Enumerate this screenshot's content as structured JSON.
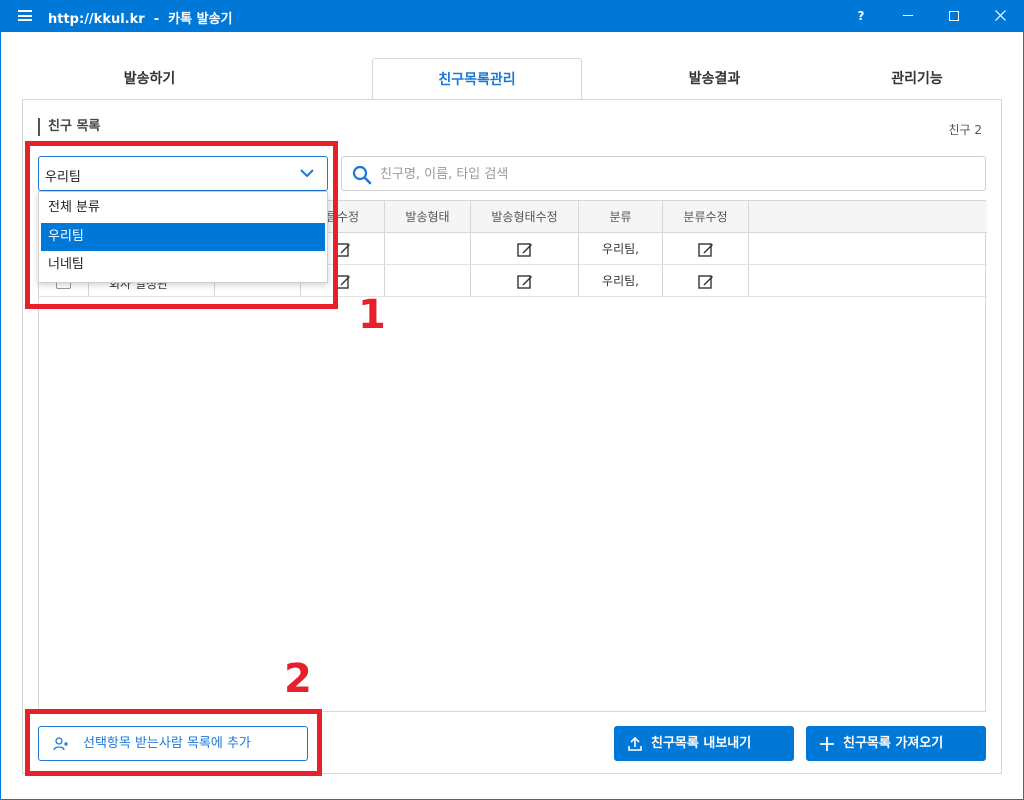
{
  "window": {
    "title": "http://kkul.kr  -  카톡 발송기",
    "help_label": "?"
  },
  "tabs": [
    {
      "label": "발송하기",
      "active": false
    },
    {
      "label": "친구목록관리",
      "active": true
    },
    {
      "label": "발송결과",
      "active": false
    },
    {
      "label": "관리기능",
      "active": false
    }
  ],
  "section": {
    "title": "친구 목록",
    "count_label": "친구 2"
  },
  "category_select": {
    "selected": "우리팀",
    "options": [
      "전체 분류",
      "우리팀",
      "너네팀"
    ]
  },
  "search": {
    "placeholder": "친구명, 이름, 타입 검색",
    "value": ""
  },
  "table": {
    "headers": [
      "름수정",
      "발송형태",
      "발송형태수정",
      "분류",
      "분류수정"
    ],
    "rows": [
      {
        "send_type": "",
        "category": "우리팀,"
      },
      {
        "send_type": "",
        "category": "우리팀,",
        "name_partial": "회사 일정관"
      }
    ]
  },
  "buttons": {
    "add_to_recipients": "선택항목 받는사람 목록에 추가",
    "export": "친구목록 내보내기",
    "import": "친구목록 가져오기"
  },
  "annotations": {
    "marker_1": "1",
    "marker_2": "2"
  },
  "colors": {
    "accent": "#0078d7",
    "highlight": "#e8202a"
  }
}
